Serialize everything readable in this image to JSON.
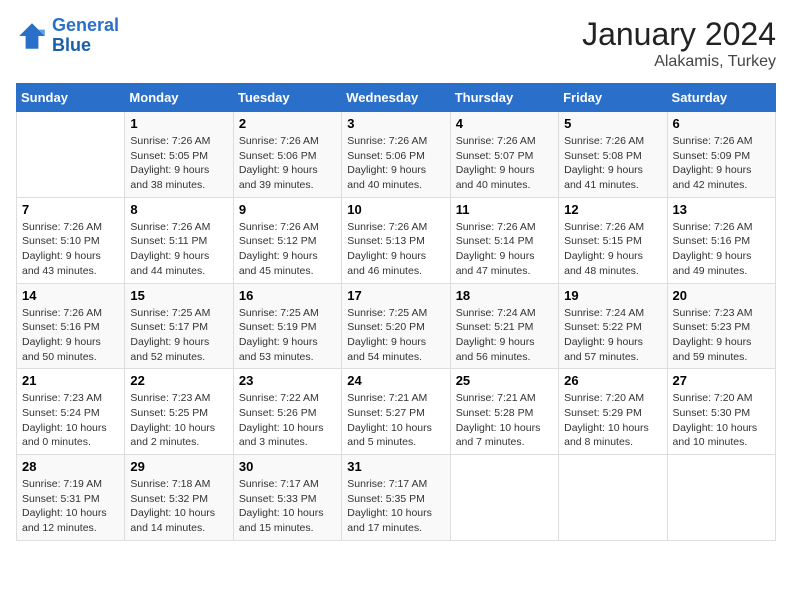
{
  "header": {
    "logo_line1": "General",
    "logo_line2": "Blue",
    "month": "January 2024",
    "location": "Alakamis, Turkey"
  },
  "weekdays": [
    "Sunday",
    "Monday",
    "Tuesday",
    "Wednesday",
    "Thursday",
    "Friday",
    "Saturday"
  ],
  "weeks": [
    [
      {
        "day": "",
        "sunrise": "",
        "sunset": "",
        "daylight": ""
      },
      {
        "day": "1",
        "sunrise": "Sunrise: 7:26 AM",
        "sunset": "Sunset: 5:05 PM",
        "daylight": "Daylight: 9 hours and 38 minutes."
      },
      {
        "day": "2",
        "sunrise": "Sunrise: 7:26 AM",
        "sunset": "Sunset: 5:06 PM",
        "daylight": "Daylight: 9 hours and 39 minutes."
      },
      {
        "day": "3",
        "sunrise": "Sunrise: 7:26 AM",
        "sunset": "Sunset: 5:06 PM",
        "daylight": "Daylight: 9 hours and 40 minutes."
      },
      {
        "day": "4",
        "sunrise": "Sunrise: 7:26 AM",
        "sunset": "Sunset: 5:07 PM",
        "daylight": "Daylight: 9 hours and 40 minutes."
      },
      {
        "day": "5",
        "sunrise": "Sunrise: 7:26 AM",
        "sunset": "Sunset: 5:08 PM",
        "daylight": "Daylight: 9 hours and 41 minutes."
      },
      {
        "day": "6",
        "sunrise": "Sunrise: 7:26 AM",
        "sunset": "Sunset: 5:09 PM",
        "daylight": "Daylight: 9 hours and 42 minutes."
      }
    ],
    [
      {
        "day": "7",
        "sunrise": "Sunrise: 7:26 AM",
        "sunset": "Sunset: 5:10 PM",
        "daylight": "Daylight: 9 hours and 43 minutes."
      },
      {
        "day": "8",
        "sunrise": "Sunrise: 7:26 AM",
        "sunset": "Sunset: 5:11 PM",
        "daylight": "Daylight: 9 hours and 44 minutes."
      },
      {
        "day": "9",
        "sunrise": "Sunrise: 7:26 AM",
        "sunset": "Sunset: 5:12 PM",
        "daylight": "Daylight: 9 hours and 45 minutes."
      },
      {
        "day": "10",
        "sunrise": "Sunrise: 7:26 AM",
        "sunset": "Sunset: 5:13 PM",
        "daylight": "Daylight: 9 hours and 46 minutes."
      },
      {
        "day": "11",
        "sunrise": "Sunrise: 7:26 AM",
        "sunset": "Sunset: 5:14 PM",
        "daylight": "Daylight: 9 hours and 47 minutes."
      },
      {
        "day": "12",
        "sunrise": "Sunrise: 7:26 AM",
        "sunset": "Sunset: 5:15 PM",
        "daylight": "Daylight: 9 hours and 48 minutes."
      },
      {
        "day": "13",
        "sunrise": "Sunrise: 7:26 AM",
        "sunset": "Sunset: 5:16 PM",
        "daylight": "Daylight: 9 hours and 49 minutes."
      }
    ],
    [
      {
        "day": "14",
        "sunrise": "Sunrise: 7:26 AM",
        "sunset": "Sunset: 5:16 PM",
        "daylight": "Daylight: 9 hours and 50 minutes."
      },
      {
        "day": "15",
        "sunrise": "Sunrise: 7:25 AM",
        "sunset": "Sunset: 5:17 PM",
        "daylight": "Daylight: 9 hours and 52 minutes."
      },
      {
        "day": "16",
        "sunrise": "Sunrise: 7:25 AM",
        "sunset": "Sunset: 5:19 PM",
        "daylight": "Daylight: 9 hours and 53 minutes."
      },
      {
        "day": "17",
        "sunrise": "Sunrise: 7:25 AM",
        "sunset": "Sunset: 5:20 PM",
        "daylight": "Daylight: 9 hours and 54 minutes."
      },
      {
        "day": "18",
        "sunrise": "Sunrise: 7:24 AM",
        "sunset": "Sunset: 5:21 PM",
        "daylight": "Daylight: 9 hours and 56 minutes."
      },
      {
        "day": "19",
        "sunrise": "Sunrise: 7:24 AM",
        "sunset": "Sunset: 5:22 PM",
        "daylight": "Daylight: 9 hours and 57 minutes."
      },
      {
        "day": "20",
        "sunrise": "Sunrise: 7:23 AM",
        "sunset": "Sunset: 5:23 PM",
        "daylight": "Daylight: 9 hours and 59 minutes."
      }
    ],
    [
      {
        "day": "21",
        "sunrise": "Sunrise: 7:23 AM",
        "sunset": "Sunset: 5:24 PM",
        "daylight": "Daylight: 10 hours and 0 minutes."
      },
      {
        "day": "22",
        "sunrise": "Sunrise: 7:23 AM",
        "sunset": "Sunset: 5:25 PM",
        "daylight": "Daylight: 10 hours and 2 minutes."
      },
      {
        "day": "23",
        "sunrise": "Sunrise: 7:22 AM",
        "sunset": "Sunset: 5:26 PM",
        "daylight": "Daylight: 10 hours and 3 minutes."
      },
      {
        "day": "24",
        "sunrise": "Sunrise: 7:21 AM",
        "sunset": "Sunset: 5:27 PM",
        "daylight": "Daylight: 10 hours and 5 minutes."
      },
      {
        "day": "25",
        "sunrise": "Sunrise: 7:21 AM",
        "sunset": "Sunset: 5:28 PM",
        "daylight": "Daylight: 10 hours and 7 minutes."
      },
      {
        "day": "26",
        "sunrise": "Sunrise: 7:20 AM",
        "sunset": "Sunset: 5:29 PM",
        "daylight": "Daylight: 10 hours and 8 minutes."
      },
      {
        "day": "27",
        "sunrise": "Sunrise: 7:20 AM",
        "sunset": "Sunset: 5:30 PM",
        "daylight": "Daylight: 10 hours and 10 minutes."
      }
    ],
    [
      {
        "day": "28",
        "sunrise": "Sunrise: 7:19 AM",
        "sunset": "Sunset: 5:31 PM",
        "daylight": "Daylight: 10 hours and 12 minutes."
      },
      {
        "day": "29",
        "sunrise": "Sunrise: 7:18 AM",
        "sunset": "Sunset: 5:32 PM",
        "daylight": "Daylight: 10 hours and 14 minutes."
      },
      {
        "day": "30",
        "sunrise": "Sunrise: 7:17 AM",
        "sunset": "Sunset: 5:33 PM",
        "daylight": "Daylight: 10 hours and 15 minutes."
      },
      {
        "day": "31",
        "sunrise": "Sunrise: 7:17 AM",
        "sunset": "Sunset: 5:35 PM",
        "daylight": "Daylight: 10 hours and 17 minutes."
      },
      {
        "day": "",
        "sunrise": "",
        "sunset": "",
        "daylight": ""
      },
      {
        "day": "",
        "sunrise": "",
        "sunset": "",
        "daylight": ""
      },
      {
        "day": "",
        "sunrise": "",
        "sunset": "",
        "daylight": ""
      }
    ]
  ]
}
